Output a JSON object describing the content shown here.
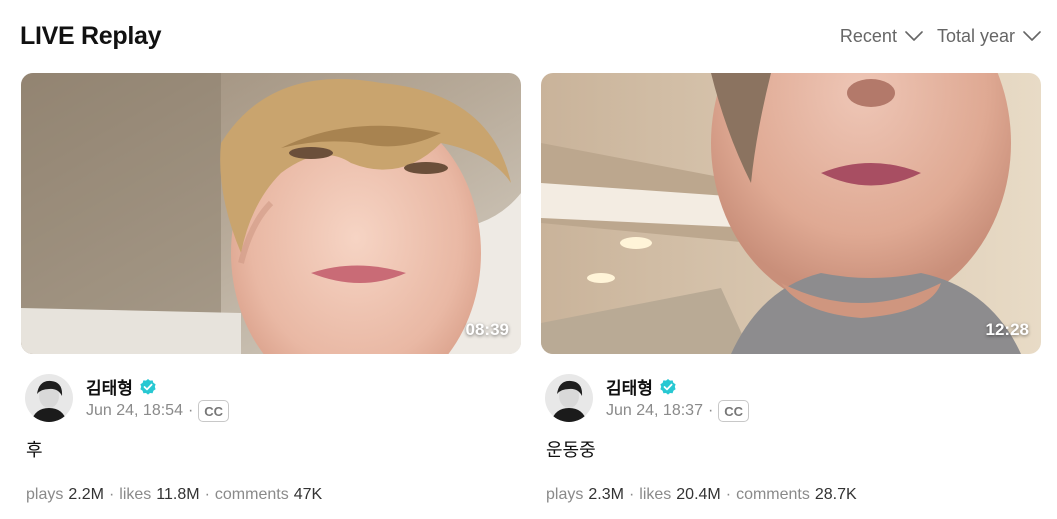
{
  "header": {
    "title": "LIVE Replay",
    "sort_filter": "Recent",
    "period_filter": "Total year"
  },
  "colors": {
    "verified": "#28c8d2",
    "meta_text": "#8a8a8a"
  },
  "cards": [
    {
      "duration": "08:39",
      "author": "김태형",
      "date": "Jun 24, 18:54",
      "separator": "·",
      "cc": "CC",
      "title": "후",
      "plays_label": "plays",
      "plays": "2.2M",
      "likes_label": "likes",
      "likes": "11.8M",
      "comments_label": "comments",
      "comments": "47K"
    },
    {
      "duration": "12:28",
      "author": "김태형",
      "date": "Jun 24, 18:37",
      "separator": "·",
      "cc": "CC",
      "title": "운동중",
      "plays_label": "plays",
      "plays": "2.3M",
      "likes_label": "likes",
      "likes": "20.4M",
      "comments_label": "comments",
      "comments": "28.7K"
    }
  ],
  "icons": {
    "filter_chevron": "chevron-down-icon",
    "verified": "verified-badge-icon"
  }
}
